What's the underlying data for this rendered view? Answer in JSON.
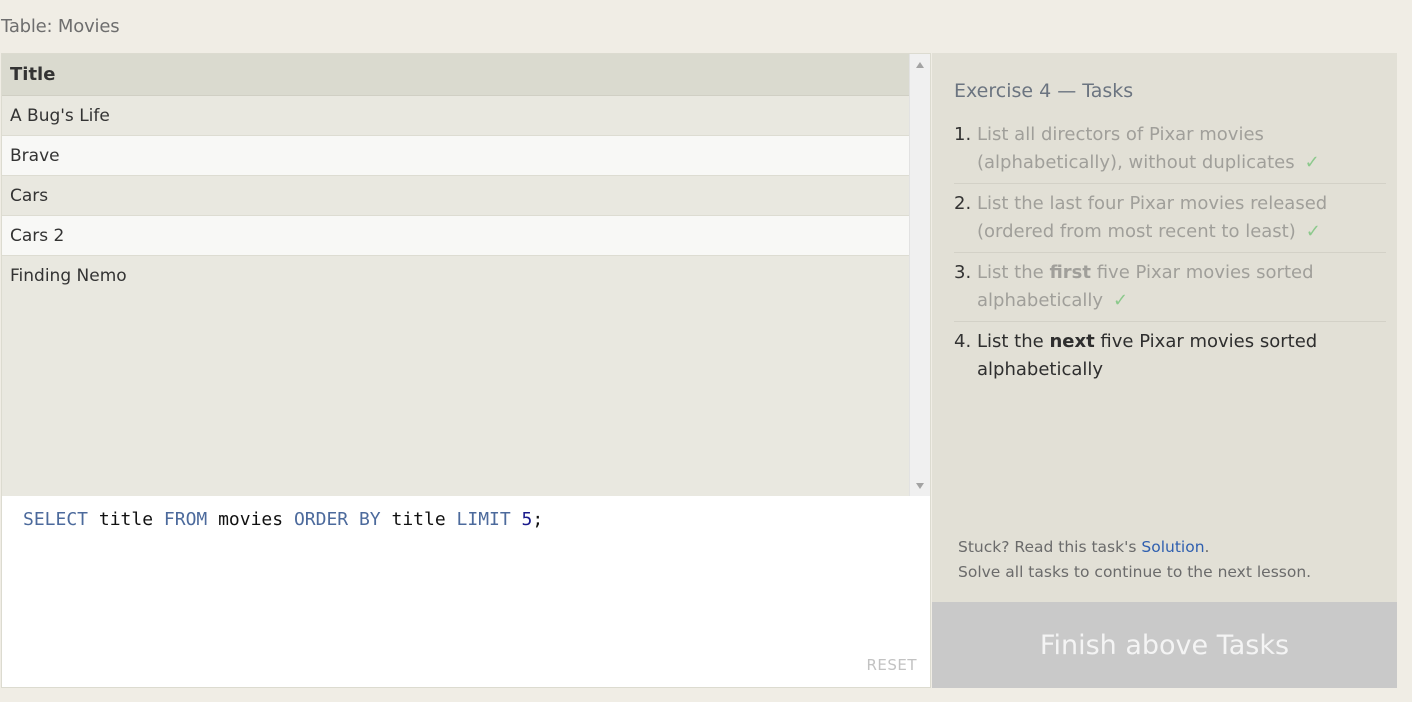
{
  "table_caption": "Table: Movies",
  "results": {
    "column_header": "Title",
    "rows": [
      "A Bug's Life",
      "Brave",
      "Cars",
      "Cars 2",
      "Finding Nemo"
    ]
  },
  "editor": {
    "tokens": [
      {
        "t": "SELECT",
        "k": "kw"
      },
      {
        "t": " title ",
        "k": "id"
      },
      {
        "t": "FROM",
        "k": "kw"
      },
      {
        "t": " movies ",
        "k": "id"
      },
      {
        "t": "ORDER BY",
        "k": "kw"
      },
      {
        "t": " title ",
        "k": "id"
      },
      {
        "t": "LIMIT",
        "k": "kw"
      },
      {
        "t": " ",
        "k": "id"
      },
      {
        "t": "5",
        "k": "num"
      },
      {
        "t": ";",
        "k": "id"
      }
    ],
    "reset_label": "RESET"
  },
  "tasks": {
    "title": "Exercise 4 — Tasks",
    "items": [
      {
        "num": "1.",
        "done": true,
        "parts": [
          {
            "t": "List all directors of Pixar movies (alphabetically), without duplicates"
          }
        ]
      },
      {
        "num": "2.",
        "done": true,
        "parts": [
          {
            "t": "List the last four Pixar movies released (ordered from most recent to least)"
          }
        ]
      },
      {
        "num": "3.",
        "done": true,
        "parts": [
          {
            "t": "List the "
          },
          {
            "t": "first",
            "b": true
          },
          {
            "t": " five Pixar movies sorted alphabetically"
          }
        ]
      },
      {
        "num": "4.",
        "done": false,
        "parts": [
          {
            "t": "List the "
          },
          {
            "t": "next",
            "b": true
          },
          {
            "t": " five Pixar movies sorted alphabetically"
          }
        ]
      }
    ],
    "check_glyph": "✓",
    "stuck_prefix": "Stuck? Read this task's ",
    "solution_link": "Solution",
    "stuck_suffix": ".",
    "continue_text": "Solve all tasks to continue to the next lesson."
  },
  "finish_button_label": "Finish above Tasks"
}
